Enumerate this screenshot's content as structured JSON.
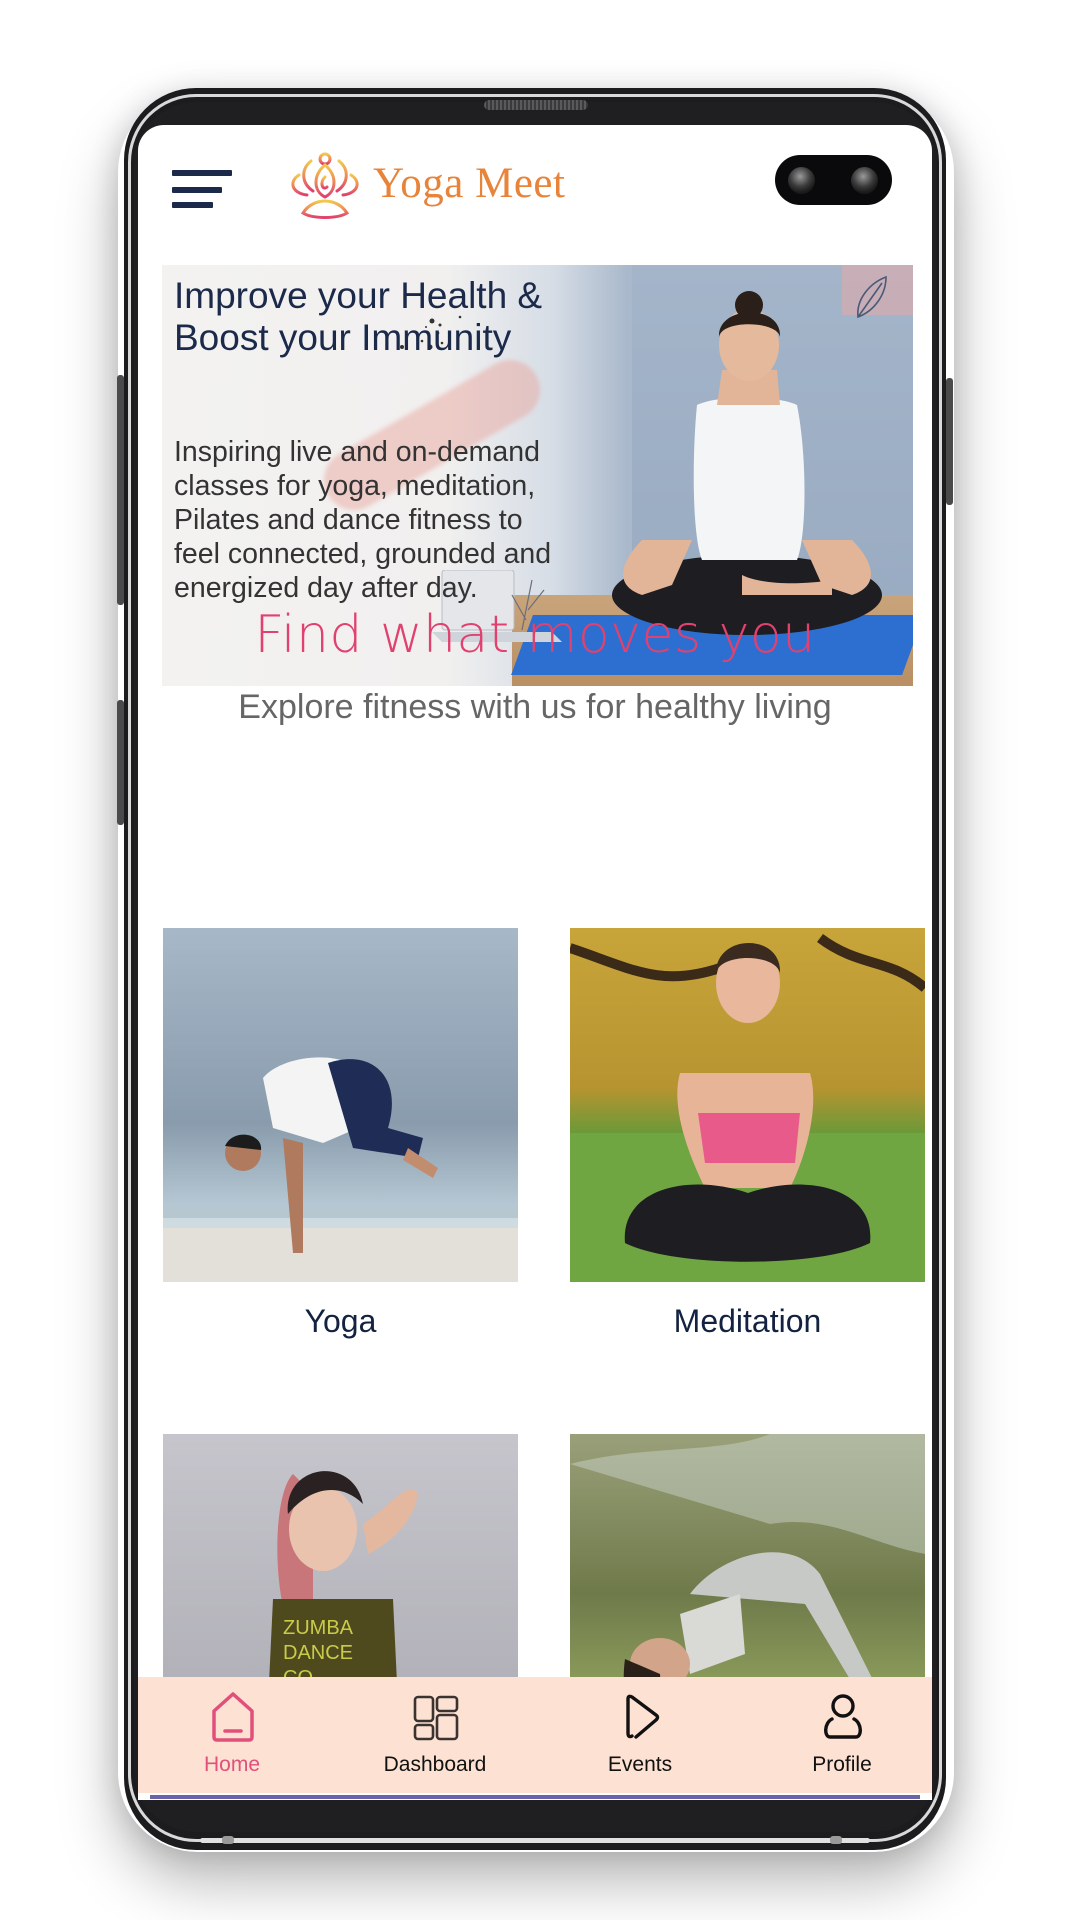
{
  "app": {
    "brand_name": "Yoga Meet",
    "menu_icon": "hamburger-menu-icon",
    "logo_icon": "lotus-meditation-logo-icon",
    "colors": {
      "brand_orange": "#e8843a",
      "accent_pink": "#e0416f",
      "navy": "#1b2a4a",
      "nav_background": "#fde1d2",
      "nav_active": "#e0507a"
    }
  },
  "banner": {
    "title": "Improve your Health & Boost your Immunity",
    "body": "Inspiring live and on-demand classes for yoga, meditation, Pilates and dance fitness to feel connected, grounded and energized day after day.",
    "image": "woman-meditating-on-yoga-mat"
  },
  "section": {
    "title": "Find what moves you",
    "subtitle": "Explore fitness with us for healthy living"
  },
  "categories": [
    {
      "label": "Yoga",
      "image": "man-crow-pose-on-beach"
    },
    {
      "label": "Meditation",
      "image": "woman-seated-namaste-on-grass"
    },
    {
      "label": "",
      "image": "woman-dance-fitness-zumba-top"
    },
    {
      "label": "",
      "image": "woman-stretching-in-park"
    }
  ],
  "nav": {
    "items": [
      {
        "label": "Home",
        "icon": "home-icon",
        "active": true
      },
      {
        "label": "Dashboard",
        "icon": "dashboard-grid-icon",
        "active": false
      },
      {
        "label": "Events",
        "icon": "play-icon",
        "active": false
      },
      {
        "label": "Profile",
        "icon": "user-icon",
        "active": false
      }
    ]
  }
}
